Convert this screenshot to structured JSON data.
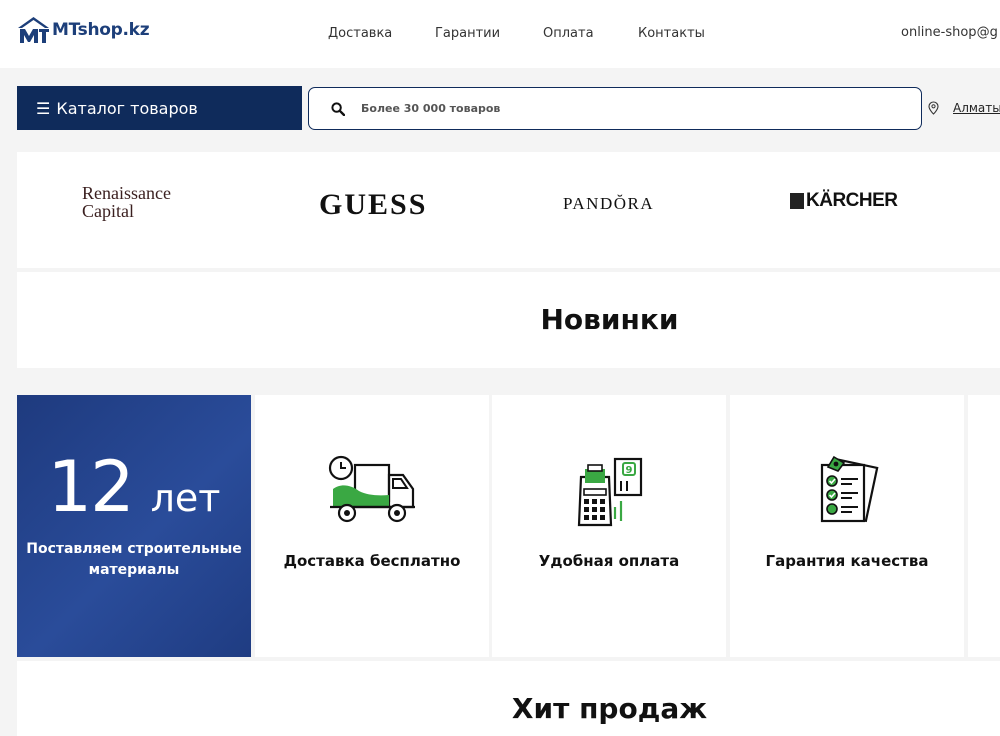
{
  "header": {
    "logo_text": "MTshop.kz",
    "nav": [
      "Доставка",
      "Гарантии",
      "Оплата",
      "Контакты"
    ],
    "email": "online-shop@g"
  },
  "catalog": {
    "label": "Каталог товаров"
  },
  "search": {
    "placeholder": "Более 30 000 товаров"
  },
  "city": {
    "label": "Алматы"
  },
  "brands": {
    "renaissance_line1": "Renaissance",
    "renaissance_line2": "Capital",
    "guess": "GUESS",
    "pandora": "PANDŎRA",
    "karcher": "KÄRCHER"
  },
  "sections": {
    "novinki": "Новинки",
    "hits": "Хит продаж"
  },
  "years": {
    "number": "12",
    "unit": "лет",
    "text": "Поставляем строительные материалы"
  },
  "features": [
    {
      "label": "Доставка бесплатно",
      "icon": "delivery-truck-icon"
    },
    {
      "label": "Удобная оплата",
      "icon": "payment-terminal-icon"
    },
    {
      "label": "Гарантия качества",
      "icon": "quality-checklist-icon"
    }
  ],
  "colors": {
    "navy": "#0f2b5b",
    "accent_green": "#3aa843",
    "card_blue": "#244690"
  }
}
